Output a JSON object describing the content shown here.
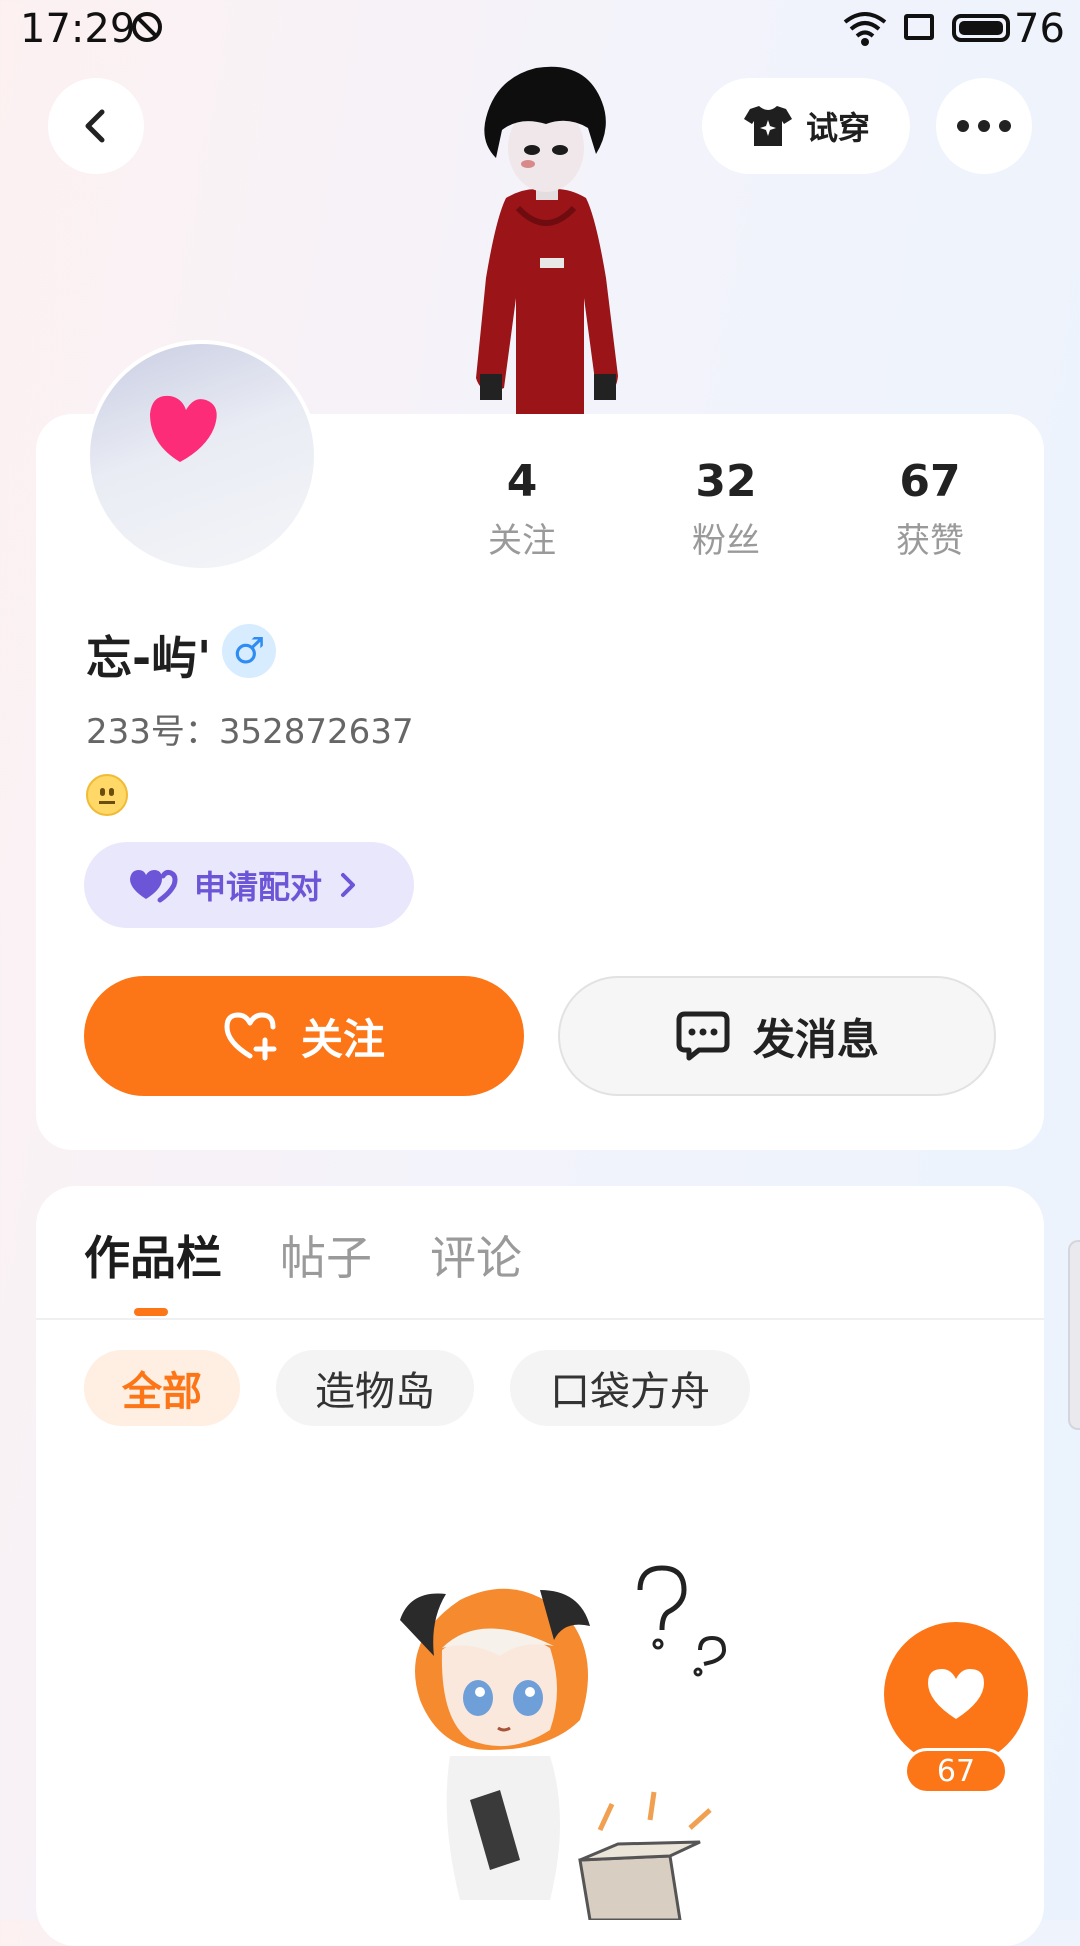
{
  "status_bar": {
    "time": "17:29",
    "battery": "76"
  },
  "header": {
    "try_on_label": "试穿"
  },
  "profile": {
    "stats": [
      {
        "value": "4",
        "label": "关注"
      },
      {
        "value": "32",
        "label": "粉丝"
      },
      {
        "value": "67",
        "label": "获赞"
      }
    ],
    "name": "忘-屿'",
    "gender_symbol": "♂",
    "uid": "233号：352872637",
    "pair_label": "申请配对",
    "follow_label": "关注",
    "message_label": "发消息"
  },
  "works": {
    "tabs": [
      "作品栏",
      "帖子",
      "评论"
    ],
    "filters": [
      "全部",
      "造物岛",
      "口袋方舟"
    ]
  },
  "like": {
    "count": "67"
  },
  "colors": {
    "accent": "#fc7617",
    "pair_purple": "#6d55d8",
    "gender_blue": "#2f8cf2"
  },
  "icons": [
    "back-icon",
    "shirt-icon",
    "more-icon",
    "heart-icon",
    "heart-plus-icon",
    "chat-icon",
    "chevron-right-icon"
  ]
}
